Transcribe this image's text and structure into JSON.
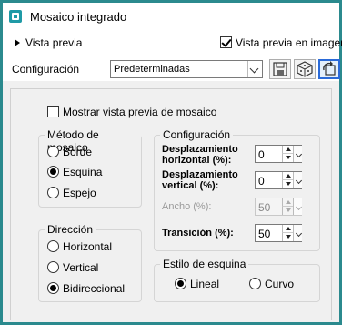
{
  "window": {
    "title": "Mosaico integrado",
    "border_color": "#2b8a8e",
    "icon": "tile-app-icon"
  },
  "preview": {
    "toggle_label": "Vista previa",
    "checkbox_label": "Vista previa en imagen",
    "checked": true
  },
  "config": {
    "label": "Configuración",
    "preset_value": "Predeterminadas",
    "buttons": [
      "save-icon",
      "randomize-icon",
      "reset-icon"
    ]
  },
  "tile_preview": {
    "label": "Mostrar vista previa de mosaico",
    "checked": false
  },
  "method": {
    "title": "Método de mosaico",
    "options": [
      {
        "label": "Borde",
        "selected": false
      },
      {
        "label": "Esquina",
        "selected": true
      },
      {
        "label": "Espejo",
        "selected": false
      }
    ]
  },
  "settings": {
    "title": "Configuración",
    "h_offset": {
      "label_1": "Desplazamiento",
      "label_2": "horizontal (%):",
      "value": "0"
    },
    "v_offset": {
      "label_1": "Desplazamiento",
      "label_2": "vertical (%):",
      "value": "0"
    },
    "width": {
      "label": "Ancho (%):",
      "value": "50",
      "disabled": true
    },
    "transition": {
      "label": "Transición (%):",
      "value": "50"
    }
  },
  "direction": {
    "title": "Dirección",
    "options": [
      {
        "label": "Horizontal",
        "selected": false
      },
      {
        "label": "Vertical",
        "selected": false
      },
      {
        "label": "Bidireccional",
        "selected": true
      }
    ]
  },
  "corner": {
    "title": "Estilo de esquina",
    "options": [
      {
        "label": "Lineal",
        "selected": true
      },
      {
        "label": "Curvo",
        "selected": false
      }
    ]
  }
}
